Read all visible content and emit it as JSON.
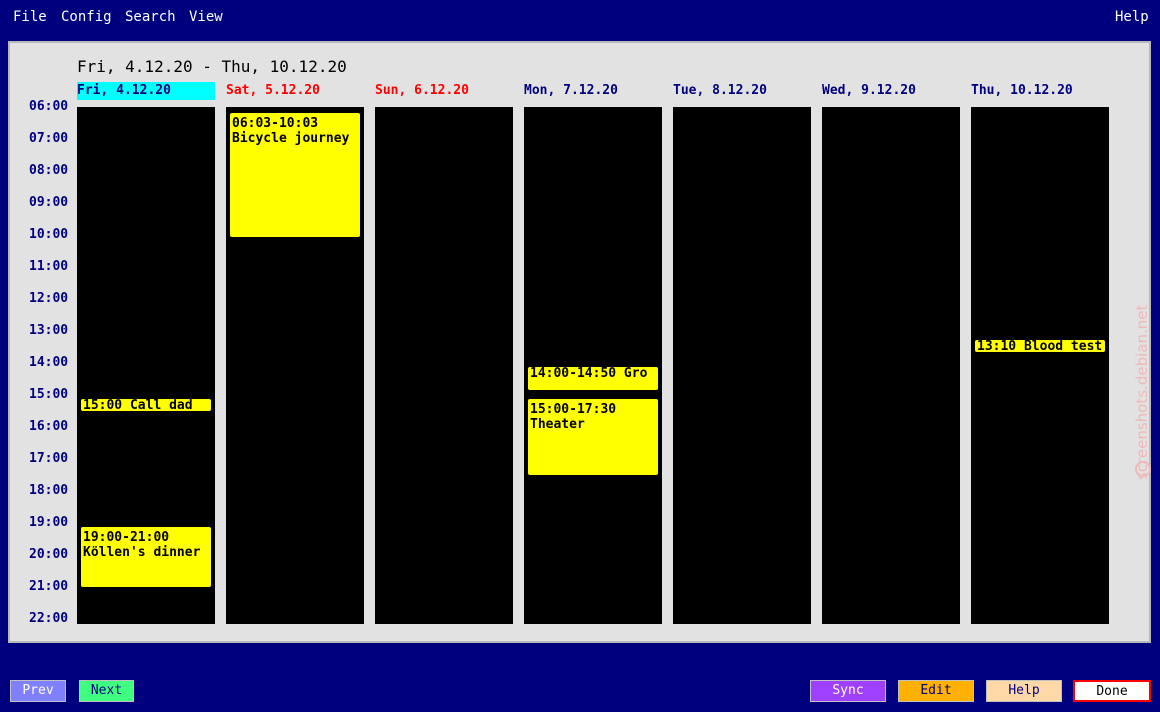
{
  "menu": {
    "file": "File",
    "config": "Config",
    "search": "Search",
    "view": "View",
    "help": "Help"
  },
  "week_title": "Fri, 4.12.20 - Thu, 10.12.20",
  "days": [
    {
      "label": "Fri, 4.12.20",
      "color": "#00007f",
      "today": true
    },
    {
      "label": "Sat, 5.12.20",
      "color": "#ff0000"
    },
    {
      "label": "Sun, 6.12.20",
      "color": "#ff0000"
    },
    {
      "label": "Mon, 7.12.20",
      "color": "#00007f"
    },
    {
      "label": "Tue, 8.12.20",
      "color": "#00007f"
    },
    {
      "label": "Wed, 9.12.20",
      "color": "#00007f"
    },
    {
      "label": "Thu, 10.12.20",
      "color": "#00007f"
    }
  ],
  "hours": [
    "06:00",
    "07:00",
    "08:00",
    "09:00",
    "10:00",
    "11:00",
    "12:00",
    "13:00",
    "14:00",
    "15:00",
    "16:00",
    "17:00",
    "18:00",
    "19:00",
    "20:00",
    "21:00",
    "22:00"
  ],
  "events": [
    {
      "day": "Fri, 4.12.20",
      "start": "15:00",
      "end": "15:25",
      "lines": [
        "15:00 Call dad"
      ]
    },
    {
      "day": "Fri, 4.12.20",
      "start": "19:00",
      "end": "21:00",
      "lines": [
        "19:00-21:00",
        "Köllen's dinner"
      ]
    },
    {
      "day": "Sat, 5.12.20",
      "start": "06:03",
      "end": "10:03",
      "lines": [
        "06:03-10:03",
        "Bicycle journey"
      ]
    },
    {
      "day": "Mon, 7.12.20",
      "start": "14:00",
      "end": "14:50",
      "lines": [
        "14:00-14:50 Gro"
      ]
    },
    {
      "day": "Mon, 7.12.20",
      "start": "15:00",
      "end": "17:30",
      "lines": [
        "15:00-17:30",
        "Theater"
      ]
    },
    {
      "day": "Thu, 10.12.20",
      "start": "13:10",
      "end": "13:35",
      "lines": [
        "13:10 Blood test"
      ]
    }
  ],
  "buttons": {
    "prev": {
      "label": "Prev",
      "bg": "#8080ff",
      "fg": "#ffffff"
    },
    "next": {
      "label": "Next",
      "bg": "#40ff80",
      "fg": "#00007f"
    },
    "sync": {
      "label": "Sync",
      "bg": "#a040ff",
      "fg": "#ffffff"
    },
    "edit": {
      "label": "Edit",
      "bg": "#ffb000",
      "fg": "#00007f"
    },
    "help": {
      "label": "Help",
      "bg": "#ffd8a8",
      "fg": "#00007f"
    },
    "done": {
      "label": "Done",
      "bg": "#ffffff",
      "fg": "#000000",
      "border": "#ff0000"
    }
  },
  "watermark": "screenshots.debian.net",
  "colors": {
    "background": "#00007f",
    "panel": "#e2e2e2",
    "column": "#a0cc60",
    "event": "#ffff00",
    "today_highlight": "#00ffff"
  }
}
